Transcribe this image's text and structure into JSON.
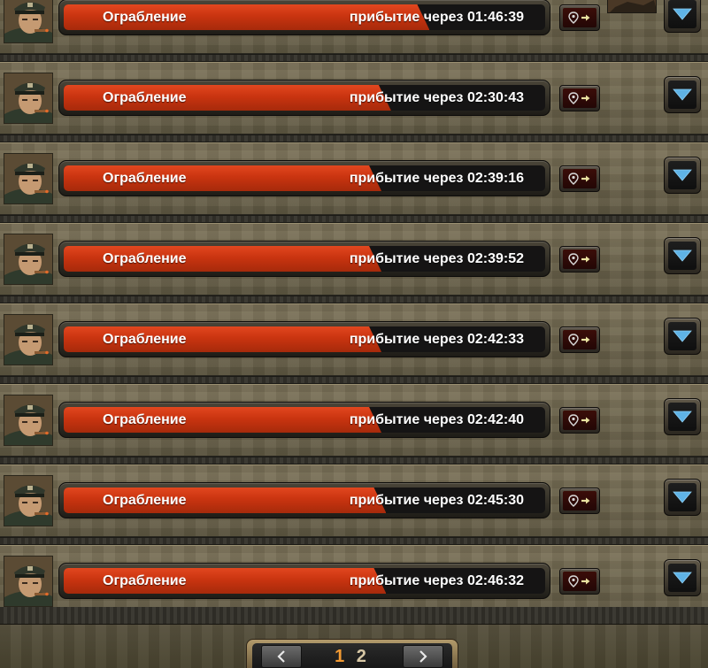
{
  "colors": {
    "progress_fill": "#c93410",
    "progress_track": "#151414",
    "text": "#ffffff",
    "current_page": "#f39a33",
    "expand_arrow": "#5fb3e6"
  },
  "rows": [
    {
      "mission": "Ограбление",
      "arrival": "прибытие через 01:46:39",
      "progress": 0.76,
      "show_thumbnail": true
    },
    {
      "mission": "Ограбление",
      "arrival": "прибытие через 02:30:43",
      "progress": 0.68,
      "show_thumbnail": false
    },
    {
      "mission": "Ограбление",
      "arrival": "прибытие через 02:39:16",
      "progress": 0.66,
      "show_thumbnail": false
    },
    {
      "mission": "Ограбление",
      "arrival": "прибытие через 02:39:52",
      "progress": 0.66,
      "show_thumbnail": false
    },
    {
      "mission": "Ограбление",
      "arrival": "прибытие через 02:42:33",
      "progress": 0.66,
      "show_thumbnail": false
    },
    {
      "mission": "Ограбление",
      "arrival": "прибытие через 02:42:40",
      "progress": 0.66,
      "show_thumbnail": false
    },
    {
      "mission": "Ограбление",
      "arrival": "прибытие через 02:45:30",
      "progress": 0.67,
      "show_thumbnail": false
    },
    {
      "mission": "Ограбление",
      "arrival": "прибытие через 02:46:32",
      "progress": 0.67,
      "show_thumbnail": false
    }
  ],
  "icons": {
    "avatar": "officer-portrait-icon",
    "locate": "map-pin-arrow-icon",
    "expand": "triangle-down-icon",
    "prev": "chevron-left-icon",
    "next": "chevron-right-icon"
  },
  "pagination": {
    "pages": [
      "1",
      "2"
    ],
    "current_page": "1"
  }
}
